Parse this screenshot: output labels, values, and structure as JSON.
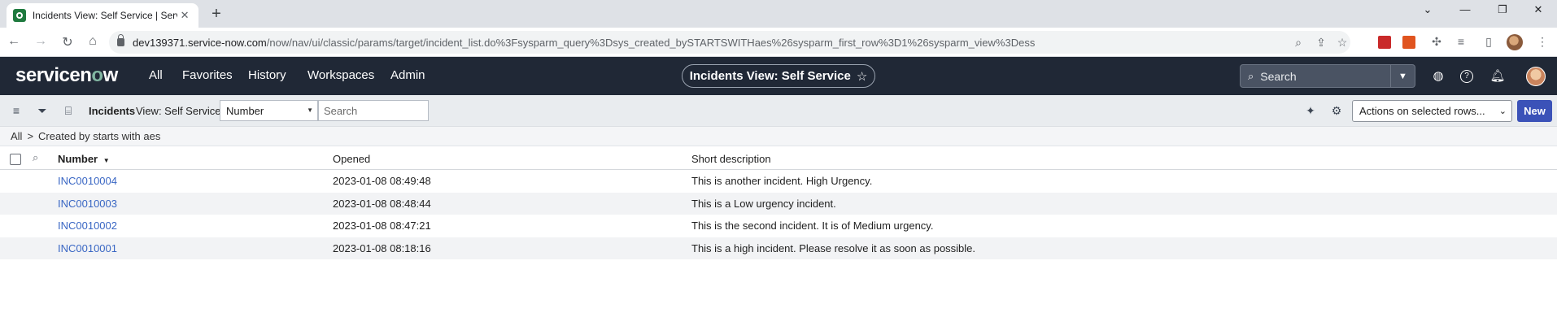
{
  "browser": {
    "tab_title": "Incidents View: Self Service | Serv",
    "tab_close": "✕",
    "new_tab": "+",
    "url_host": "dev139371.service-now.com",
    "url_path": "/now/nav/ui/classic/params/target/incident_list.do%3Fsysparm_query%3Dsys_created_bySTARTSWITHaes%26sysparm_first_row%3D1%26sysparm_view%3Dess"
  },
  "header": {
    "logo": "servicenow",
    "nav": [
      "All",
      "Favorites",
      "History",
      "Workspaces",
      "Admin"
    ],
    "page_title": "Incidents View: Self Service",
    "search_placeholder": "Search"
  },
  "toolbar": {
    "list_title": "Incidents",
    "view_label": "View: Self Service",
    "field_select": "Number",
    "search_placeholder": "Search",
    "actions_select": "Actions on selected rows...",
    "new_label": "New"
  },
  "breadcrumb": {
    "root": "All",
    "separator": ">",
    "filter": "Created by starts with aes"
  },
  "table": {
    "columns": [
      "Number",
      "Opened",
      "Short description"
    ],
    "sort_indicator": "▼",
    "rows": [
      {
        "number": "INC0010004",
        "opened": "2023-01-08 08:49:48",
        "description": "This is another incident. High Urgency."
      },
      {
        "number": "INC0010003",
        "opened": "2023-01-08 08:48:44",
        "description": "This is a Low urgency incident."
      },
      {
        "number": "INC0010002",
        "opened": "2023-01-08 08:47:21",
        "description": "This is the second incident. It is of Medium urgency."
      },
      {
        "number": "INC0010001",
        "opened": "2023-01-08 08:18:16",
        "description": "This is a high incident. Please resolve it as soon as possible."
      }
    ]
  },
  "colors": {
    "header_bg": "#202836",
    "link": "#3a67c4",
    "primary_button": "#3b52b8"
  }
}
